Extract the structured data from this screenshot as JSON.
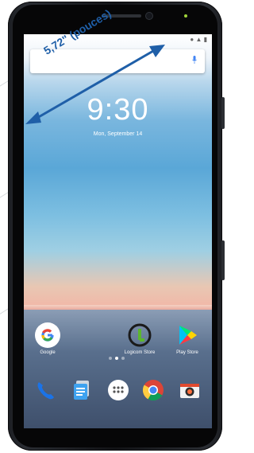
{
  "annotation": {
    "size_label": "5,72\" (pouces)",
    "arrow_color": "#1f5fa8"
  },
  "screen": {
    "clock": "9:30",
    "date": "Mon, September 14",
    "search_bar": {
      "placeholder": "",
      "mic_icon": "mic-icon"
    }
  },
  "home_apps": [
    {
      "label": "Google",
      "icon": "google-icon"
    },
    {
      "label": "Logicom Store",
      "icon": "logicom-store-icon"
    },
    {
      "label": "Play Store",
      "icon": "play-store-icon"
    }
  ],
  "dock": [
    {
      "icon": "phone-icon"
    },
    {
      "icon": "messages-icon"
    },
    {
      "icon": "app-drawer-icon"
    },
    {
      "icon": "chrome-icon"
    },
    {
      "icon": "camera-icon"
    }
  ],
  "page_indicator": {
    "pages": 3,
    "active": 2
  }
}
